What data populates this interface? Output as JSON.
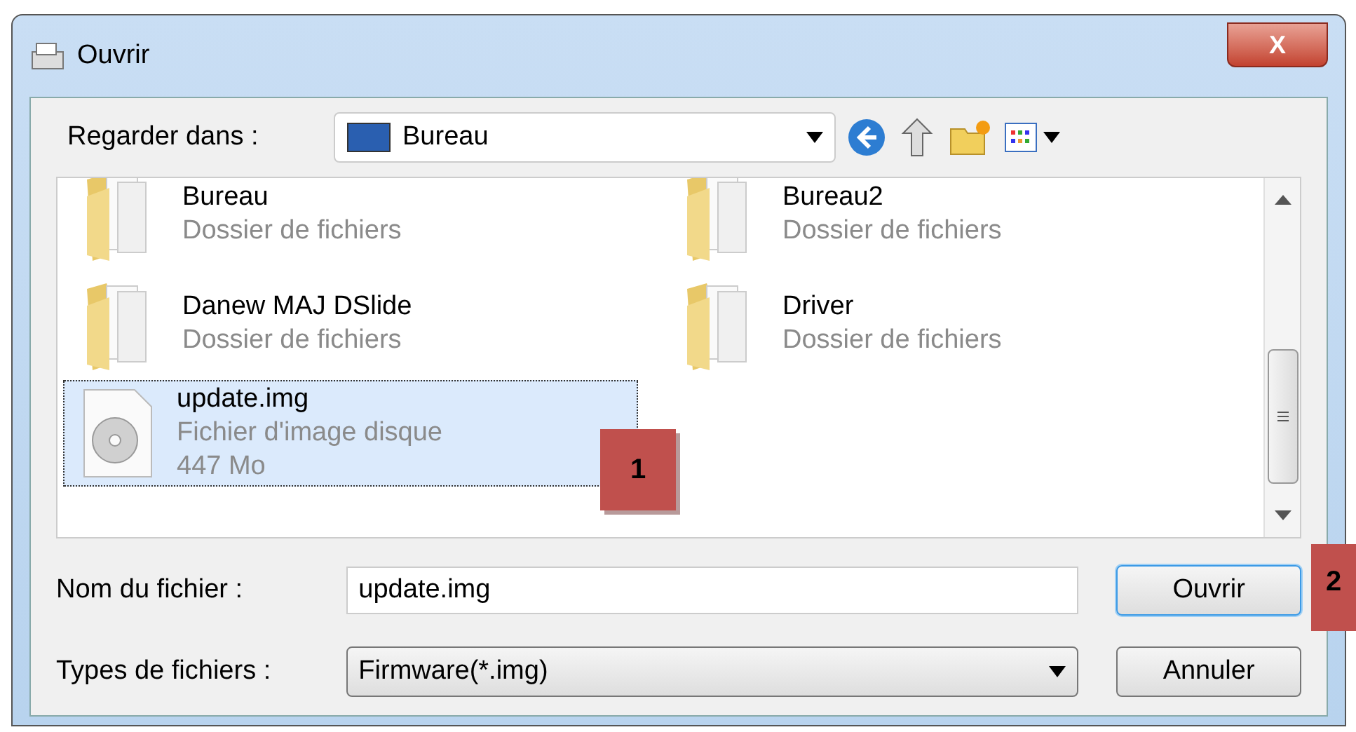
{
  "window": {
    "title": "Ouvrir",
    "close_label": "X"
  },
  "look_in": {
    "label": "Regarder dans :",
    "value": "Bureau"
  },
  "files": [
    {
      "kind": "folder",
      "name": "Bureau",
      "type": "Dossier de fichiers",
      "selected": false
    },
    {
      "kind": "folder",
      "name": "Bureau2",
      "type": "Dossier de fichiers",
      "selected": false
    },
    {
      "kind": "folder",
      "name": "Danew MAJ DSlide",
      "type": "Dossier de fichiers",
      "selected": false
    },
    {
      "kind": "folder",
      "name": "Driver",
      "type": "Dossier de fichiers",
      "selected": false
    },
    {
      "kind": "disc",
      "name": "update.img",
      "type": "Fichier d'image disque",
      "size": "447 Mo",
      "selected": true
    }
  ],
  "file_name": {
    "label": "Nom du fichier :",
    "value": "update.img"
  },
  "file_type": {
    "label": "Types de fichiers :",
    "value": "Firmware(*.img)"
  },
  "buttons": [
    {
      "label": "Ouvrir",
      "default": true
    },
    {
      "label": "Annuler",
      "default": false
    }
  ],
  "annotations": [
    "1",
    "2"
  ]
}
